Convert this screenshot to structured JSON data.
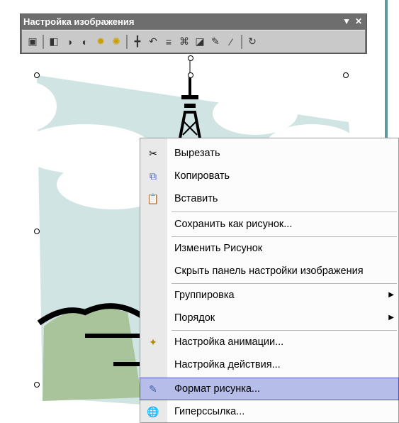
{
  "toolbar": {
    "title": "Настройка изображения",
    "dropdown_glyph": "▼",
    "close_glyph": "✕",
    "buttons": [
      {
        "icon": "insert-picture-icon",
        "glyph": "▣"
      },
      {
        "icon": "color-icon",
        "glyph": "◧"
      },
      {
        "icon": "more-contrast-icon",
        "glyph": "◑"
      },
      {
        "icon": "less-contrast-icon",
        "glyph": "◐"
      },
      {
        "icon": "more-brightness-icon",
        "glyph": "✹"
      },
      {
        "icon": "less-brightness-icon",
        "glyph": "✺"
      },
      {
        "icon": "crop-icon",
        "glyph": "╋"
      },
      {
        "icon": "rotate-left-icon",
        "glyph": "↶"
      },
      {
        "icon": "line-style-icon",
        "glyph": "≡"
      },
      {
        "icon": "compress-pictures-icon",
        "glyph": "⌘"
      },
      {
        "icon": "recolor-picture-icon",
        "glyph": "◪"
      },
      {
        "icon": "format-picture-icon",
        "glyph": "✎"
      },
      {
        "icon": "set-transparent-color-icon",
        "glyph": "⁄"
      },
      {
        "icon": "reset-picture-icon",
        "glyph": "↻"
      }
    ]
  },
  "context_menu": {
    "items": [
      {
        "label": "Вырезать",
        "icon": "scissors-icon",
        "glyph": "✂",
        "submenu": false
      },
      {
        "label": "Копировать",
        "icon": "copy-icon",
        "glyph": "⧉",
        "submenu": false
      },
      {
        "label": "Вставить",
        "icon": "paste-icon",
        "glyph": "📋",
        "submenu": false
      },
      {
        "label": "Сохранить как рисунок...",
        "icon": "",
        "glyph": "",
        "submenu": false
      },
      {
        "label": "Изменить Рисунок",
        "icon": "",
        "glyph": "",
        "submenu": false
      },
      {
        "label": "Скрыть панель настройки изображения",
        "icon": "",
        "glyph": "",
        "submenu": false
      },
      {
        "label": "Группировка",
        "icon": "",
        "glyph": "",
        "submenu": true
      },
      {
        "label": "Порядок",
        "icon": "",
        "glyph": "",
        "submenu": true
      },
      {
        "label": "Настройка анимации...",
        "icon": "animation-icon",
        "glyph": "✦",
        "submenu": false
      },
      {
        "label": "Настройка действия...",
        "icon": "",
        "glyph": "",
        "submenu": false
      },
      {
        "label": "Формат рисунка...",
        "icon": "format-picture-icon",
        "glyph": "✎",
        "submenu": false,
        "highlighted": true
      },
      {
        "label": "Гиперссылка...",
        "icon": "hyperlink-icon",
        "glyph": "🌐",
        "submenu": false
      }
    ],
    "submenu_arrow": "▶"
  },
  "colors": {
    "sky": "#cfe4e3",
    "cloud": "#ffffff",
    "grass": "#a9c49a",
    "highlight": "#b6bde8",
    "toolbar_title": "#6e6e6e"
  }
}
